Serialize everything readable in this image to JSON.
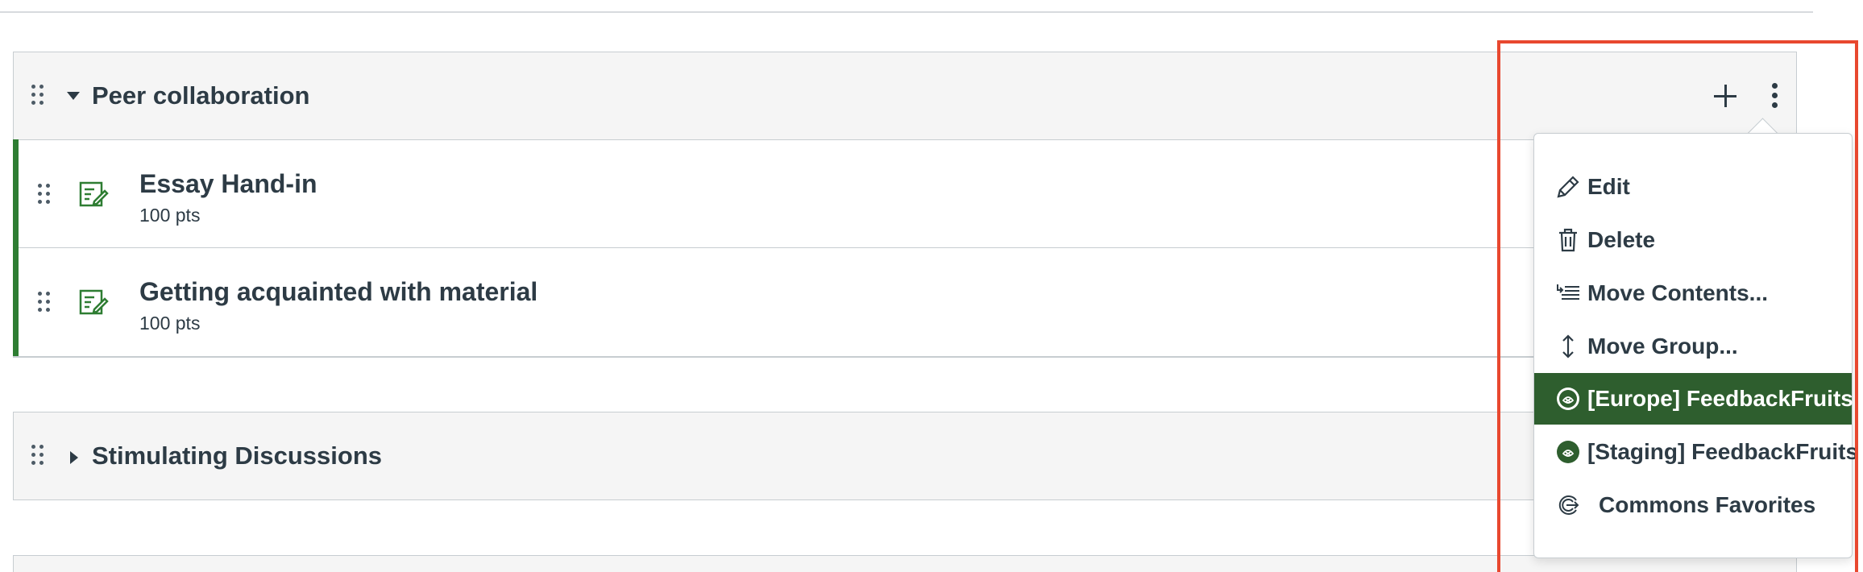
{
  "modules": [
    {
      "title": "Peer collaboration",
      "expanded": true,
      "items": [
        {
          "title": "Essay Hand-in",
          "points": "100 pts"
        },
        {
          "title": "Getting acquainted with material",
          "points": "100 pts"
        }
      ]
    },
    {
      "title": "Stimulating Discussions",
      "expanded": false
    }
  ],
  "menu": {
    "items": [
      {
        "label": "Edit",
        "icon": "pencil-icon"
      },
      {
        "label": "Delete",
        "icon": "trash-icon"
      },
      {
        "label": "Move Contents...",
        "icon": "move-contents-icon"
      },
      {
        "label": "Move Group...",
        "icon": "move-vertical-icon"
      },
      {
        "label": "[Europe] FeedbackFruits",
        "icon": "feedbackfruits-icon",
        "active": true
      },
      {
        "label": "[Staging] FeedbackFruits",
        "icon": "feedbackfruits-icon"
      },
      {
        "label": "Commons Favorites",
        "icon": "commons-icon"
      }
    ]
  },
  "colors": {
    "accent_green": "#2e7d32",
    "menu_active": "#2e5e2e",
    "highlight": "#e8482f",
    "text": "#2d3b45"
  }
}
